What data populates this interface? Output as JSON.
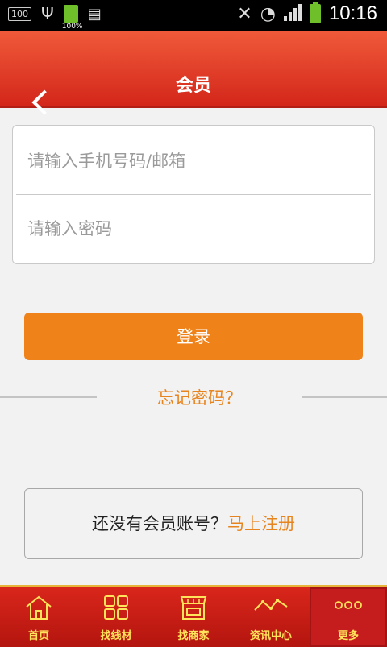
{
  "status_bar": {
    "box_text": "100",
    "battery_small_text": "100%",
    "time": "10:16"
  },
  "header": {
    "title": "会员"
  },
  "login_form": {
    "phone_placeholder": "请输入手机号码/邮箱",
    "password_placeholder": "请输入密码"
  },
  "login_button": "登录",
  "forgot_password": "忘记密码？",
  "register": {
    "prompt": "还没有会员账号？",
    "link": "马上注册"
  },
  "bottom_nav": {
    "items": [
      {
        "label": "首页",
        "icon": "home-icon"
      },
      {
        "label": "找线材",
        "icon": "grid-icon"
      },
      {
        "label": "找商家",
        "icon": "store-icon"
      },
      {
        "label": "资讯中心",
        "icon": "news-icon"
      },
      {
        "label": "更多",
        "icon": "more-icon"
      }
    ],
    "active_index": 4
  },
  "colors": {
    "header_red": "#d3261a",
    "accent_orange": "#f0821a",
    "nav_text_yellow": "#ffe35a"
  }
}
